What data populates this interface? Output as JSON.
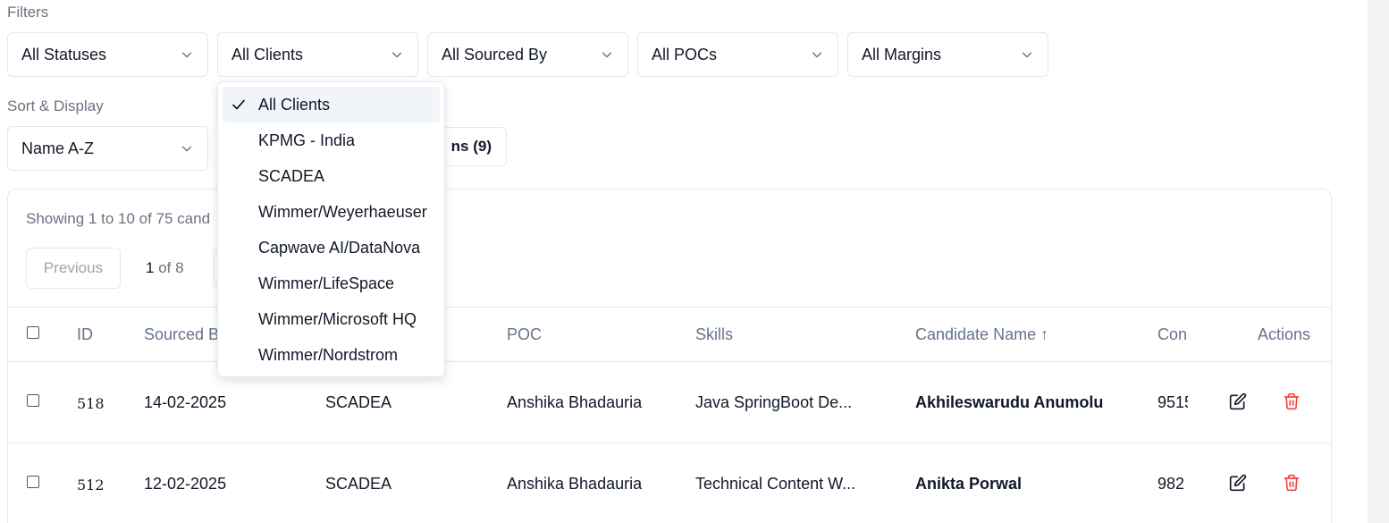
{
  "filters": {
    "label": "Filters",
    "statuses": "All Statuses",
    "clients": "All Clients",
    "sourced_by": "All Sourced By",
    "pocs": "All POCs",
    "margins": "All Margins"
  },
  "sort_display": {
    "label": "Sort & Display",
    "sort": "Name A-Z",
    "columns_button": "ns (9)"
  },
  "pagination": {
    "showing": "Showing 1 to 10 of 75 cand",
    "previous": "Previous",
    "current_page": "1",
    "of_pages": " of 8"
  },
  "table": {
    "headers": {
      "id": "ID",
      "sourced": "Sourced B",
      "poc": "POC",
      "skills": "Skills",
      "candidate": "Candidate Name ↑",
      "contact": "Con",
      "actions": "Actions"
    },
    "rows": [
      {
        "id": "518",
        "date": "14-02-2025",
        "client": "SCADEA",
        "poc": "Anshika Bhadauria",
        "skills": "Java SpringBoot De...",
        "name": "Akhileswarudu Anumolu",
        "contact": "9515"
      },
      {
        "id": "512",
        "date": "12-02-2025",
        "client": "SCADEA",
        "poc": "Anshika Bhadauria",
        "skills": "Technical Content W...",
        "name": "Anikta Porwal",
        "contact": "982"
      }
    ]
  },
  "client_dropdown": {
    "options": [
      "All Clients",
      "KPMG - India",
      "SCADEA",
      "Wimmer/Weyerhaeuser",
      "Capwave AI/DataNova",
      "Wimmer/LifeSpace",
      "Wimmer/Microsoft HQ",
      "Wimmer/Nordstrom"
    ],
    "selected": "All Clients"
  },
  "colors": {
    "delete": "#ef4444",
    "muted": "#6b7280",
    "header": "#64748b"
  }
}
